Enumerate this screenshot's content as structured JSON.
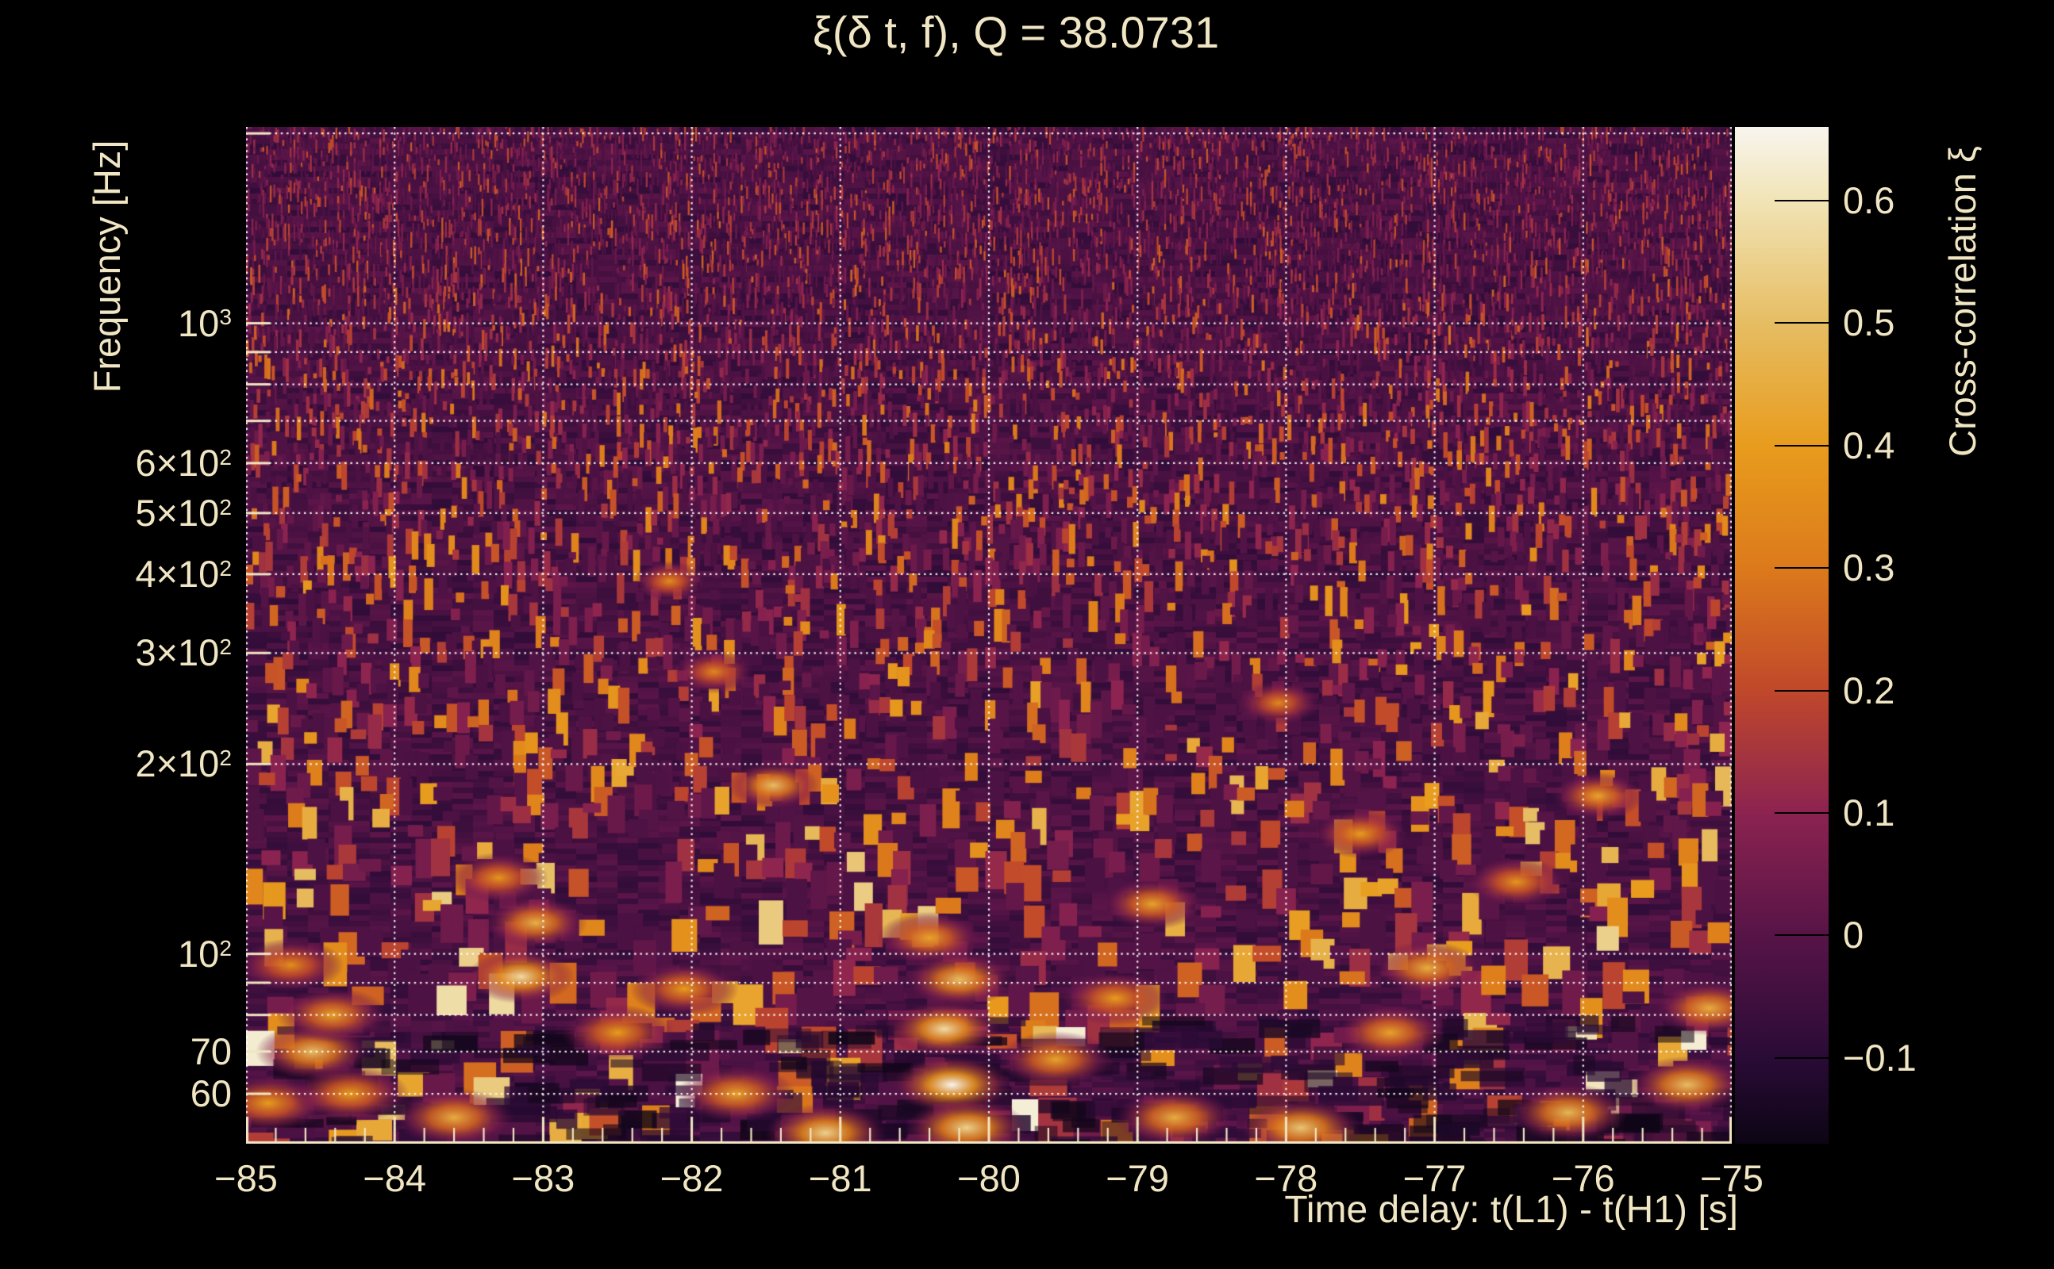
{
  "chart_data": {
    "type": "heatmap",
    "title": "ξ(δ t, f), Q = 38.0731",
    "q_value": 38.0731,
    "xlabel": "Time delay: t(L1) - t(H1) [s]",
    "ylabel": "Frequency [Hz]",
    "colorbar_label": "Cross-correlation ξ",
    "background_color": "#000000",
    "text_color": "#f1e6c3",
    "x_axis": {
      "range": [
        -85,
        -75
      ],
      "major_ticks": [
        -85,
        -84,
        -83,
        -82,
        -81,
        -80,
        -79,
        -78,
        -77,
        -76,
        -75
      ],
      "major_tick_labels": [
        "−85",
        "−84",
        "−83",
        "−82",
        "−81",
        "−80",
        "−79",
        "−78",
        "−77",
        "−76",
        "−75"
      ],
      "minor_tick_step": 0.2
    },
    "y_axis": {
      "scale": "log",
      "range_hz": [
        50,
        2048
      ],
      "labeled_ticks": [
        {
          "prefix": "10",
          "sup": "3",
          "value": 1000
        },
        {
          "prefix": "6×10",
          "sup": "2",
          "value": 600
        },
        {
          "prefix": "5×10",
          "sup": "2",
          "value": 500
        },
        {
          "prefix": "4×10",
          "sup": "2",
          "value": 400
        },
        {
          "prefix": "3×10",
          "sup": "2",
          "value": 300
        },
        {
          "prefix": "2×10",
          "sup": "2",
          "value": 200
        },
        {
          "prefix": "10",
          "sup": "2",
          "value": 100
        },
        {
          "prefix": "70",
          "sup": "",
          "value": 70
        },
        {
          "prefix": "60",
          "sup": "",
          "value": 60
        }
      ],
      "gridline_freqs": [
        60,
        70,
        80,
        90,
        100,
        200,
        300,
        400,
        500,
        600,
        700,
        800,
        900,
        1000,
        2000
      ]
    },
    "grid": {
      "style": "dotted",
      "color": "#ffffff"
    },
    "colorbar": {
      "range": [
        -0.17,
        0.66
      ],
      "ticks": [
        {
          "value": 0.6,
          "label": "0.6"
        },
        {
          "value": 0.5,
          "label": "0.5"
        },
        {
          "value": 0.4,
          "label": "0.4"
        },
        {
          "value": 0.3,
          "label": "0.3"
        },
        {
          "value": 0.2,
          "label": "0.2"
        },
        {
          "value": 0.1,
          "label": "0.1"
        },
        {
          "value": 0,
          "label": "0"
        },
        {
          "value": -0.1,
          "label": "−0.1"
        }
      ],
      "colormap_stops": [
        [
          -0.17,
          "#0c0514"
        ],
        [
          -0.1,
          "#2a0b36"
        ],
        [
          0.0,
          "#571447"
        ],
        [
          0.1,
          "#8c2350"
        ],
        [
          0.2,
          "#c0482b"
        ],
        [
          0.3,
          "#dc7a1b"
        ],
        [
          0.4,
          "#e89c1d"
        ],
        [
          0.5,
          "#e6bd63"
        ],
        [
          0.6,
          "#f1e4b6"
        ],
        [
          0.66,
          "#f8f5ee"
        ]
      ]
    },
    "texture": {
      "seed": 42,
      "base_value": -0.04,
      "description": "constant-Q spectrogram noise: fine dim-red vertical streaks at high frequency on dark purple background, progressively wider and brighter orange/yellow blobs below ~200 Hz, near-black patches in a band around 55-65 Hz"
    },
    "features": [
      {
        "t": -84.85,
        "f": 58,
        "xi": 0.4
      },
      {
        "t": -84.55,
        "f": 70,
        "xi": 0.5
      },
      {
        "t": -84.42,
        "f": 80,
        "xi": 0.42
      },
      {
        "t": -84.7,
        "f": 96,
        "xi": 0.36
      },
      {
        "t": -84.3,
        "f": 60,
        "xi": 0.4
      },
      {
        "t": -83.6,
        "f": 55,
        "xi": 0.45
      },
      {
        "t": -83.15,
        "f": 92,
        "xi": 0.58
      },
      {
        "t": -83.05,
        "f": 112,
        "xi": 0.46
      },
      {
        "t": -83.3,
        "f": 132,
        "xi": 0.38
      },
      {
        "t": -82.5,
        "f": 75,
        "xi": 0.4
      },
      {
        "t": -82.15,
        "f": 390,
        "xi": 0.36
      },
      {
        "t": -82.05,
        "f": 88,
        "xi": 0.4
      },
      {
        "t": -81.85,
        "f": 280,
        "xi": 0.34
      },
      {
        "t": -81.7,
        "f": 60,
        "xi": 0.42
      },
      {
        "t": -81.45,
        "f": 185,
        "xi": 0.5
      },
      {
        "t": -81.1,
        "f": 52,
        "xi": 0.55
      },
      {
        "t": -80.4,
        "f": 106,
        "xi": 0.42
      },
      {
        "t": -80.3,
        "f": 76,
        "xi": 0.58
      },
      {
        "t": -80.25,
        "f": 62,
        "xi": 0.66
      },
      {
        "t": -80.2,
        "f": 91,
        "xi": 0.5
      },
      {
        "t": -80.15,
        "f": 53,
        "xi": 0.55
      },
      {
        "t": -79.55,
        "f": 68,
        "xi": 0.42
      },
      {
        "t": -79.15,
        "f": 85,
        "xi": 0.4
      },
      {
        "t": -78.9,
        "f": 120,
        "xi": 0.42
      },
      {
        "t": -78.75,
        "f": 55,
        "xi": 0.45
      },
      {
        "t": -78.05,
        "f": 250,
        "xi": 0.34
      },
      {
        "t": -77.9,
        "f": 53,
        "xi": 0.52
      },
      {
        "t": -77.5,
        "f": 155,
        "xi": 0.4
      },
      {
        "t": -77.3,
        "f": 75,
        "xi": 0.42
      },
      {
        "t": -77.05,
        "f": 95,
        "xi": 0.45
      },
      {
        "t": -76.45,
        "f": 130,
        "xi": 0.38
      },
      {
        "t": -76.1,
        "f": 56,
        "xi": 0.48
      },
      {
        "t": -75.9,
        "f": 178,
        "xi": 0.42
      },
      {
        "t": -75.3,
        "f": 62,
        "xi": 0.5
      },
      {
        "t": -75.15,
        "f": 82,
        "xi": 0.45
      }
    ]
  }
}
